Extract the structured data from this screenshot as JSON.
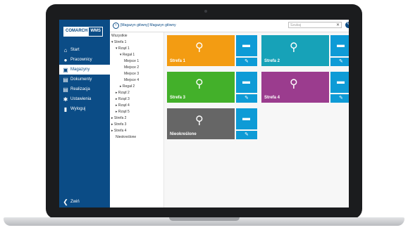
{
  "app": {
    "logo_left": "COMARCH",
    "logo_right": "WMS"
  },
  "sidebar": {
    "items": [
      {
        "label": "Start",
        "icon": "home-icon"
      },
      {
        "label": "Pracownicy",
        "icon": "user-icon"
      },
      {
        "label": "Magazyny",
        "icon": "warehouse-icon"
      },
      {
        "label": "Dokumenty",
        "icon": "document-icon"
      },
      {
        "label": "Realizacja",
        "icon": "document-icon"
      },
      {
        "label": "Ustawienia",
        "icon": "gear-icon"
      },
      {
        "label": "Wyloguj",
        "icon": "logout-icon"
      }
    ],
    "collapse_label": "Zwiń"
  },
  "header": {
    "breadcrumb": "[Magazyn główny] Magazyn główny",
    "search_placeholder": "Szukaj"
  },
  "tree": [
    {
      "label": "Wszystkie",
      "expanded": null
    },
    {
      "label": "Strefa 1",
      "expanded": true
    },
    {
      "label": "Rząd 1",
      "expanded": true
    },
    {
      "label": "Regał 1",
      "expanded": true
    },
    {
      "label": "Miejsce 1",
      "expanded": null
    },
    {
      "label": "Miejsce 2",
      "expanded": null
    },
    {
      "label": "Miejsce 3",
      "expanded": null
    },
    {
      "label": "Miejsce 4",
      "expanded": null
    },
    {
      "label": "Regał 2",
      "expanded": false
    },
    {
      "label": "Rząd 2",
      "expanded": false
    },
    {
      "label": "Rząd 3",
      "expanded": false
    },
    {
      "label": "Rząd 4",
      "expanded": false
    },
    {
      "label": "Rząd 5",
      "expanded": false
    },
    {
      "label": "Strefa 2",
      "expanded": false
    },
    {
      "label": "Strefa 3",
      "expanded": false
    },
    {
      "label": "Strefa 4",
      "expanded": false
    },
    {
      "label": "Nieokreślone",
      "expanded": null
    }
  ],
  "tiles": [
    {
      "label": "Strefa 1",
      "color": "#f39c12"
    },
    {
      "label": "Strefa 2",
      "color": "#17a2b8"
    },
    {
      "label": "Strefa 3",
      "color": "#43b02a"
    },
    {
      "label": "Strefa 4",
      "color": "#9b3c8e"
    },
    {
      "label": "Nieokreślone",
      "color": "#666666"
    }
  ],
  "colors": {
    "sidebar": "#0b4c86",
    "accent": "#0e9bd6"
  }
}
